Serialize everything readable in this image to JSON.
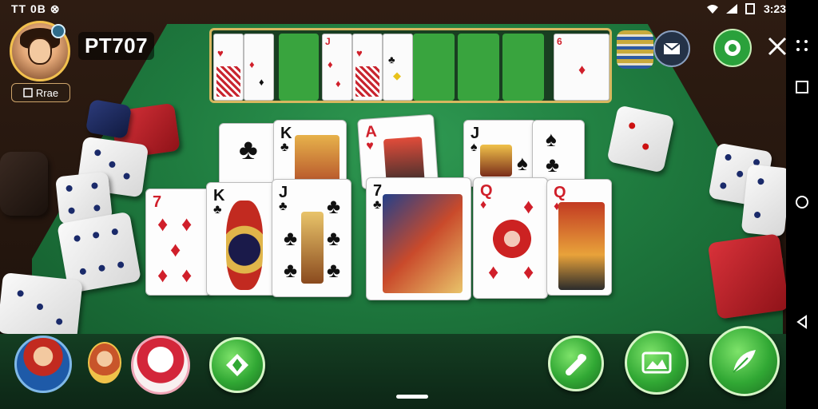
{
  "status_bar": {
    "left_text": "TT 0B ⊗",
    "time": "3:23"
  },
  "player": {
    "name": "PT707",
    "tag": "Rrae"
  },
  "top_rack": {
    "cards": [
      {
        "rank": "",
        "suit": "♥"
      },
      {
        "rank": "",
        "suit": "♦"
      },
      {
        "rank": "",
        "suit": ""
      },
      {
        "rank": "J",
        "suit": "♦"
      },
      {
        "rank": "",
        "suit": "♥"
      },
      {
        "rank": "",
        "suit": "♣"
      },
      {
        "rank": "",
        "suit": ""
      },
      {
        "rank": "",
        "suit": ""
      },
      {
        "rank": "",
        "suit": ""
      },
      {
        "rank": "6",
        "suit": "♦"
      }
    ]
  },
  "table_cards_back_row": [
    {
      "rank": "",
      "suit": "♣"
    },
    {
      "rank": "K",
      "suit": "♣"
    },
    {
      "rank": "A",
      "suit": "♥"
    },
    {
      "rank": "J",
      "suit": "♠"
    },
    {
      "rank": "",
      "suit": "♠"
    }
  ],
  "table_cards_front_row": [
    {
      "rank": "7",
      "suit": "♦"
    },
    {
      "rank": "K",
      "suit": "♣"
    },
    {
      "rank": "J",
      "suit": "♣"
    },
    {
      "rank": "7",
      "suit": "♣"
    },
    {
      "rank": "Q",
      "suit": "♦"
    },
    {
      "rank": "Q",
      "suit": "♦"
    }
  ],
  "icons": {
    "mail": "mail-icon",
    "chip": "chip-icon",
    "tools": "tools-icon",
    "diamond_move": "diamond-arrows-icon",
    "microphone": "mic-icon",
    "photo": "photo-icon",
    "feather": "feather-icon"
  },
  "colors": {
    "felt": "#1f7b3f",
    "accent_green": "#31a834",
    "rack_border": "#d7b75f",
    "red_suit": "#d01f2a"
  }
}
